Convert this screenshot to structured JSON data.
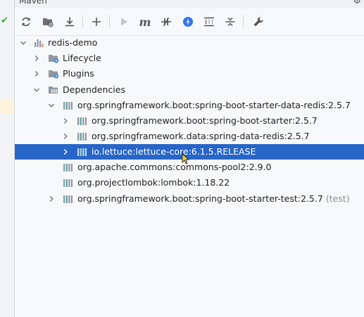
{
  "panel": {
    "title": "Maven"
  },
  "toolbar": {
    "buttons": [
      {
        "icon": "reload-icon",
        "label": "Reload All Maven Projects"
      },
      {
        "icon": "add-folder-icon",
        "label": "Generate Sources"
      },
      {
        "icon": "download-icon",
        "label": "Download Sources"
      },
      {
        "icon": "plus-icon",
        "label": "Add Maven Projects"
      },
      {
        "icon": "run-icon",
        "label": "Run Maven Build"
      },
      {
        "icon": "maven-m-icon",
        "label": "Execute Maven Goal"
      },
      {
        "icon": "toggle-offline-icon",
        "label": "Toggle Offline Mode"
      },
      {
        "icon": "skip-tests-icon",
        "label": "Toggle Skip Tests Mode"
      },
      {
        "icon": "show-dependencies-icon",
        "label": "Show Dependencies"
      },
      {
        "icon": "collapse-all-icon",
        "label": "Collapse All"
      },
      {
        "icon": "wrench-icon",
        "label": "Maven Settings"
      }
    ]
  },
  "tree": {
    "rows": [
      {
        "label": "redis-demo",
        "expanded": true
      },
      {
        "label": "Lifecycle",
        "expanded": false
      },
      {
        "label": "Plugins",
        "expanded": false
      },
      {
        "label": "Dependencies",
        "expanded": true
      },
      {
        "label": "org.springframework.boot:spring-boot-starter-data-redis:2.5.7",
        "expanded": true
      },
      {
        "label": "org.springframework.boot:spring-boot-starter:2.5.7",
        "expanded": false
      },
      {
        "label": "org.springframework.data:spring-data-redis:2.5.7",
        "expanded": false
      },
      {
        "label": "io.lettuce:lettuce-core:6.1.5.RELEASE",
        "expanded": false,
        "selected": true
      },
      {
        "label": "org.apache.commons:commons-pool2:2.9.0"
      },
      {
        "label": "org.projectlombok:lombok:1.18.22"
      },
      {
        "label": "org.springframework.boot:spring-boot-starter-test:2.5.7",
        "suffix": "(test)",
        "expanded": false
      }
    ]
  },
  "colors": {
    "selection": "#2766c7",
    "accent": "#3574f0",
    "folder": "#8f98a3",
    "library": "#5c9e9b"
  }
}
